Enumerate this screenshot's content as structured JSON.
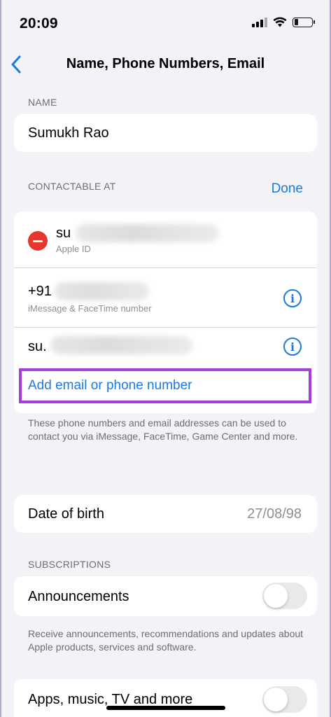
{
  "status_bar": {
    "time": "20:09"
  },
  "nav": {
    "title": "Name, Phone Numbers, Email"
  },
  "name_section": {
    "header": "NAME",
    "value": "Sumukh Rao"
  },
  "contactable": {
    "header": "CONTACTABLE AT",
    "done_label": "Done",
    "items": [
      {
        "value": "su",
        "subtitle": "Apple ID"
      },
      {
        "value": "+91",
        "subtitle": "iMessage & FaceTime number"
      },
      {
        "value": "su."
      }
    ],
    "add_label": "Add email or phone number",
    "footnote": "These phone numbers and email addresses can be used to contact you via iMessage, FaceTime, Game Center and more."
  },
  "date_of_birth": {
    "label": "Date of birth",
    "value": "27/08/98"
  },
  "subscriptions": {
    "header": "SUBSCRIPTIONS",
    "items": [
      {
        "label": "Announcements",
        "enabled": false
      },
      {
        "label": "Apps, music, TV and more",
        "enabled": false
      }
    ],
    "footnote": "Receive announcements, recommendations and updates about Apple products, services and software."
  },
  "colors": {
    "accent": "#1a7ae0",
    "destructive": "#e5372e",
    "highlight": "#a23fde",
    "background": "#f2f2f7"
  },
  "icons": {
    "back": "chevron-left-icon",
    "remove": "minus-circle-icon",
    "info": "info-circle-icon",
    "signal": "cellular-signal-icon",
    "wifi": "wifi-icon",
    "battery": "battery-icon"
  }
}
